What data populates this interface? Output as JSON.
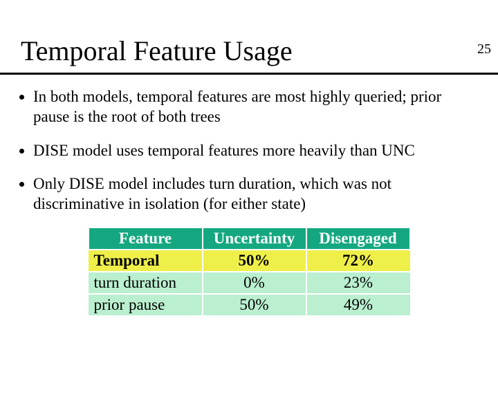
{
  "page_number": "25",
  "title": "Temporal Feature Usage",
  "bullets": [
    "In both models, temporal features are most highly queried; prior pause is the root of both trees",
    "DISE model uses temporal features more heavily than UNC",
    "Only DISE model includes turn duration, which was not discriminative in isolation (for either state)"
  ],
  "table": {
    "headers": {
      "feature": "Feature",
      "uncertainty": "Uncertainty",
      "disengaged": "Disengaged"
    },
    "rows": [
      {
        "kind": "cat",
        "feature": "Temporal",
        "uncertainty": "50%",
        "disengaged": "72%"
      },
      {
        "kind": "sub",
        "feature": "turn duration",
        "uncertainty": "0%",
        "disengaged": "23%"
      },
      {
        "kind": "sub",
        "feature": "prior pause",
        "uncertainty": "50%",
        "disengaged": "49%"
      }
    ]
  },
  "chart_data": {
    "type": "table",
    "columns": [
      "Feature",
      "Uncertainty",
      "Disengaged"
    ],
    "rows": [
      [
        "Temporal",
        "50%",
        "72%"
      ],
      [
        "turn duration",
        "0%",
        "23%"
      ],
      [
        "prior pause",
        "50%",
        "49%"
      ]
    ]
  }
}
